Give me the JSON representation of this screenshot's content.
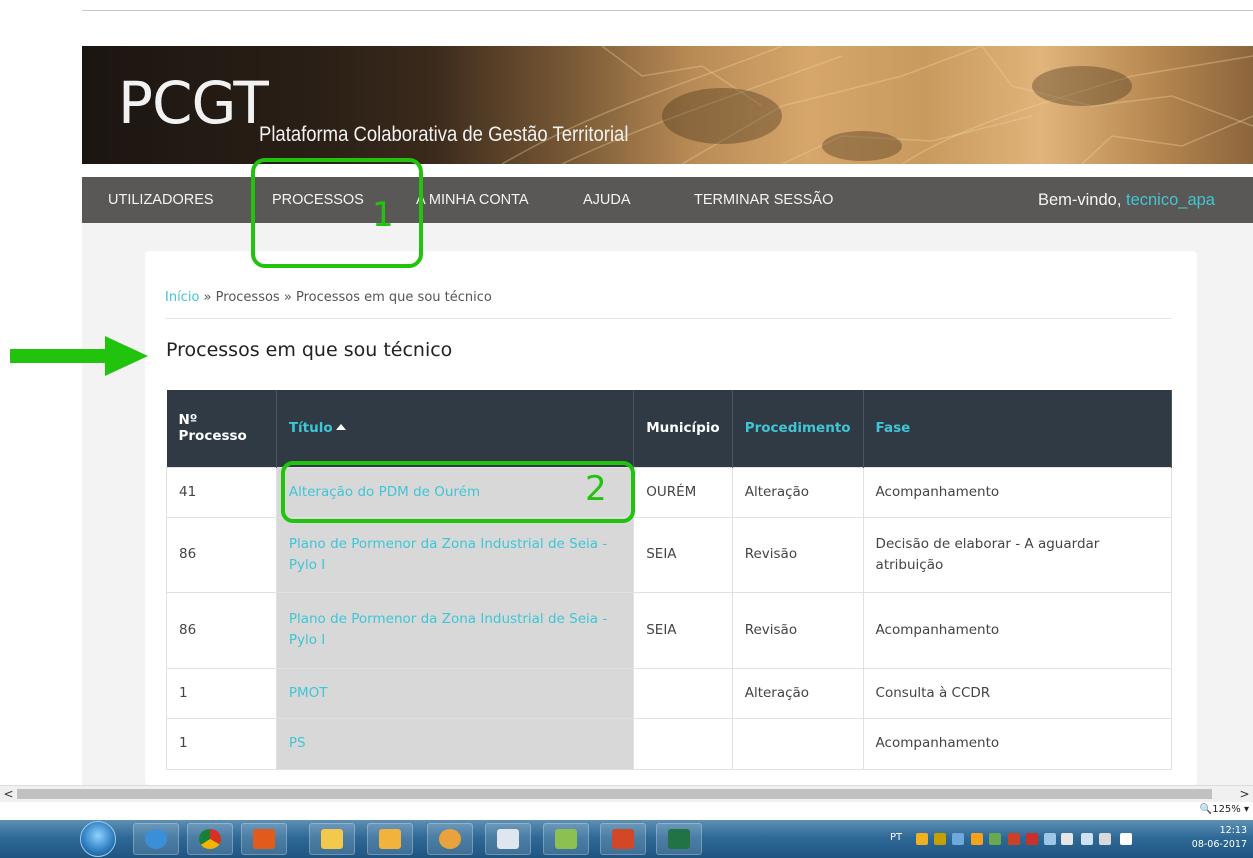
{
  "banner": {
    "logo": "PCGT",
    "subtitle": "Plataforma Colaborativa de Gestão Territorial"
  },
  "nav": {
    "items": [
      "UTILIZADORES",
      "PROCESSOS",
      "A MINHA CONTA",
      "AJUDA",
      "TERMINAR SESSÃO"
    ],
    "welcome_prefix": "Bem-vindo,",
    "username": "tecnico_apa"
  },
  "breadcrumb": {
    "home": "Início",
    "separator": "»",
    "processos": "Processos",
    "current": "Processos em que sou técnico"
  },
  "page_title": "Processos em que sou técnico",
  "table": {
    "headers": [
      "Nº Processo",
      "Título",
      "Município",
      "Procedimento",
      "Fase"
    ],
    "sorted_column": "Título",
    "sort_direction": "ascending",
    "rows": [
      {
        "numero": "41",
        "titulo": "Alteração do PDM de Ourém",
        "municipio": "OURÉM",
        "procedimento": "Alteração",
        "fase": "Acompanhamento"
      },
      {
        "numero": "86",
        "titulo": "Plano de Pormenor da Zona Industrial de Seia - Pylo I",
        "municipio": "SEIA",
        "procedimento": "Revisão",
        "fase": "Decisão de elaborar - A aguardar atribuição"
      },
      {
        "numero": "86",
        "titulo": "Plano de Pormenor da Zona Industrial de Seia - Pylo I",
        "municipio": "SEIA",
        "procedimento": "Revisão",
        "fase": "Acompanhamento"
      },
      {
        "numero": "1",
        "titulo": "PMOT",
        "municipio": "",
        "procedimento": "Alteração",
        "fase": "Consulta à CCDR"
      },
      {
        "numero": "1",
        "titulo": "PS",
        "municipio": "",
        "procedimento": "",
        "fase": "Acompanhamento"
      }
    ]
  },
  "annotations": {
    "label_1": "1",
    "label_2": "2",
    "color": "#22c30d"
  },
  "browser": {
    "zoom": "125%",
    "scroll_left": "<",
    "scroll_right": ">"
  },
  "taskbar": {
    "language": "PT",
    "time": "12:13",
    "date": "08-06-2017",
    "apps": [
      "internet-explorer",
      "chrome",
      "outlook-app",
      "file-explorer",
      "outlook",
      "paint",
      "media",
      "photos",
      "powerpoint",
      "excel"
    ]
  },
  "colors": {
    "accent": "#3ec6d6",
    "nav_bg": "#5a5856",
    "table_header_bg": "#2f3a44",
    "title_cell_bg": "#d8d8d8"
  }
}
